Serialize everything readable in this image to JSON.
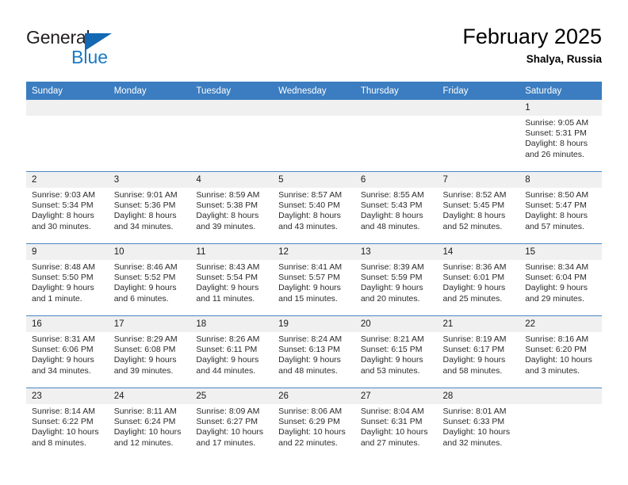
{
  "brand": {
    "line1": "General",
    "line2": "Blue",
    "triangle_color": "#1268b3",
    "blue_color": "#1a7ac4"
  },
  "header": {
    "title": "February 2025",
    "location": "Shalya, Russia"
  },
  "theme": {
    "header_bg": "#3b7dc0",
    "row_divider": "#4a86c5",
    "daynum_bg": "#f0f0f0"
  },
  "weekday_headers": [
    "Sunday",
    "Monday",
    "Tuesday",
    "Wednesday",
    "Thursday",
    "Friday",
    "Saturday"
  ],
  "weeks": [
    [
      {
        "day": "",
        "empty": true
      },
      {
        "day": "",
        "empty": true
      },
      {
        "day": "",
        "empty": true
      },
      {
        "day": "",
        "empty": true
      },
      {
        "day": "",
        "empty": true
      },
      {
        "day": "",
        "empty": true
      },
      {
        "day": "1",
        "sunrise": "Sunrise: 9:05 AM",
        "sunset": "Sunset: 5:31 PM",
        "daylight": "Daylight: 8 hours and 26 minutes."
      }
    ],
    [
      {
        "day": "2",
        "sunrise": "Sunrise: 9:03 AM",
        "sunset": "Sunset: 5:34 PM",
        "daylight": "Daylight: 8 hours and 30 minutes."
      },
      {
        "day": "3",
        "sunrise": "Sunrise: 9:01 AM",
        "sunset": "Sunset: 5:36 PM",
        "daylight": "Daylight: 8 hours and 34 minutes."
      },
      {
        "day": "4",
        "sunrise": "Sunrise: 8:59 AM",
        "sunset": "Sunset: 5:38 PM",
        "daylight": "Daylight: 8 hours and 39 minutes."
      },
      {
        "day": "5",
        "sunrise": "Sunrise: 8:57 AM",
        "sunset": "Sunset: 5:40 PM",
        "daylight": "Daylight: 8 hours and 43 minutes."
      },
      {
        "day": "6",
        "sunrise": "Sunrise: 8:55 AM",
        "sunset": "Sunset: 5:43 PM",
        "daylight": "Daylight: 8 hours and 48 minutes."
      },
      {
        "day": "7",
        "sunrise": "Sunrise: 8:52 AM",
        "sunset": "Sunset: 5:45 PM",
        "daylight": "Daylight: 8 hours and 52 minutes."
      },
      {
        "day": "8",
        "sunrise": "Sunrise: 8:50 AM",
        "sunset": "Sunset: 5:47 PM",
        "daylight": "Daylight: 8 hours and 57 minutes."
      }
    ],
    [
      {
        "day": "9",
        "sunrise": "Sunrise: 8:48 AM",
        "sunset": "Sunset: 5:50 PM",
        "daylight": "Daylight: 9 hours and 1 minute."
      },
      {
        "day": "10",
        "sunrise": "Sunrise: 8:46 AM",
        "sunset": "Sunset: 5:52 PM",
        "daylight": "Daylight: 9 hours and 6 minutes."
      },
      {
        "day": "11",
        "sunrise": "Sunrise: 8:43 AM",
        "sunset": "Sunset: 5:54 PM",
        "daylight": "Daylight: 9 hours and 11 minutes."
      },
      {
        "day": "12",
        "sunrise": "Sunrise: 8:41 AM",
        "sunset": "Sunset: 5:57 PM",
        "daylight": "Daylight: 9 hours and 15 minutes."
      },
      {
        "day": "13",
        "sunrise": "Sunrise: 8:39 AM",
        "sunset": "Sunset: 5:59 PM",
        "daylight": "Daylight: 9 hours and 20 minutes."
      },
      {
        "day": "14",
        "sunrise": "Sunrise: 8:36 AM",
        "sunset": "Sunset: 6:01 PM",
        "daylight": "Daylight: 9 hours and 25 minutes."
      },
      {
        "day": "15",
        "sunrise": "Sunrise: 8:34 AM",
        "sunset": "Sunset: 6:04 PM",
        "daylight": "Daylight: 9 hours and 29 minutes."
      }
    ],
    [
      {
        "day": "16",
        "sunrise": "Sunrise: 8:31 AM",
        "sunset": "Sunset: 6:06 PM",
        "daylight": "Daylight: 9 hours and 34 minutes."
      },
      {
        "day": "17",
        "sunrise": "Sunrise: 8:29 AM",
        "sunset": "Sunset: 6:08 PM",
        "daylight": "Daylight: 9 hours and 39 minutes."
      },
      {
        "day": "18",
        "sunrise": "Sunrise: 8:26 AM",
        "sunset": "Sunset: 6:11 PM",
        "daylight": "Daylight: 9 hours and 44 minutes."
      },
      {
        "day": "19",
        "sunrise": "Sunrise: 8:24 AM",
        "sunset": "Sunset: 6:13 PM",
        "daylight": "Daylight: 9 hours and 48 minutes."
      },
      {
        "day": "20",
        "sunrise": "Sunrise: 8:21 AM",
        "sunset": "Sunset: 6:15 PM",
        "daylight": "Daylight: 9 hours and 53 minutes."
      },
      {
        "day": "21",
        "sunrise": "Sunrise: 8:19 AM",
        "sunset": "Sunset: 6:17 PM",
        "daylight": "Daylight: 9 hours and 58 minutes."
      },
      {
        "day": "22",
        "sunrise": "Sunrise: 8:16 AM",
        "sunset": "Sunset: 6:20 PM",
        "daylight": "Daylight: 10 hours and 3 minutes."
      }
    ],
    [
      {
        "day": "23",
        "sunrise": "Sunrise: 8:14 AM",
        "sunset": "Sunset: 6:22 PM",
        "daylight": "Daylight: 10 hours and 8 minutes."
      },
      {
        "day": "24",
        "sunrise": "Sunrise: 8:11 AM",
        "sunset": "Sunset: 6:24 PM",
        "daylight": "Daylight: 10 hours and 12 minutes."
      },
      {
        "day": "25",
        "sunrise": "Sunrise: 8:09 AM",
        "sunset": "Sunset: 6:27 PM",
        "daylight": "Daylight: 10 hours and 17 minutes."
      },
      {
        "day": "26",
        "sunrise": "Sunrise: 8:06 AM",
        "sunset": "Sunset: 6:29 PM",
        "daylight": "Daylight: 10 hours and 22 minutes."
      },
      {
        "day": "27",
        "sunrise": "Sunrise: 8:04 AM",
        "sunset": "Sunset: 6:31 PM",
        "daylight": "Daylight: 10 hours and 27 minutes."
      },
      {
        "day": "28",
        "sunrise": "Sunrise: 8:01 AM",
        "sunset": "Sunset: 6:33 PM",
        "daylight": "Daylight: 10 hours and 32 minutes."
      },
      {
        "day": "",
        "empty": true
      }
    ]
  ]
}
